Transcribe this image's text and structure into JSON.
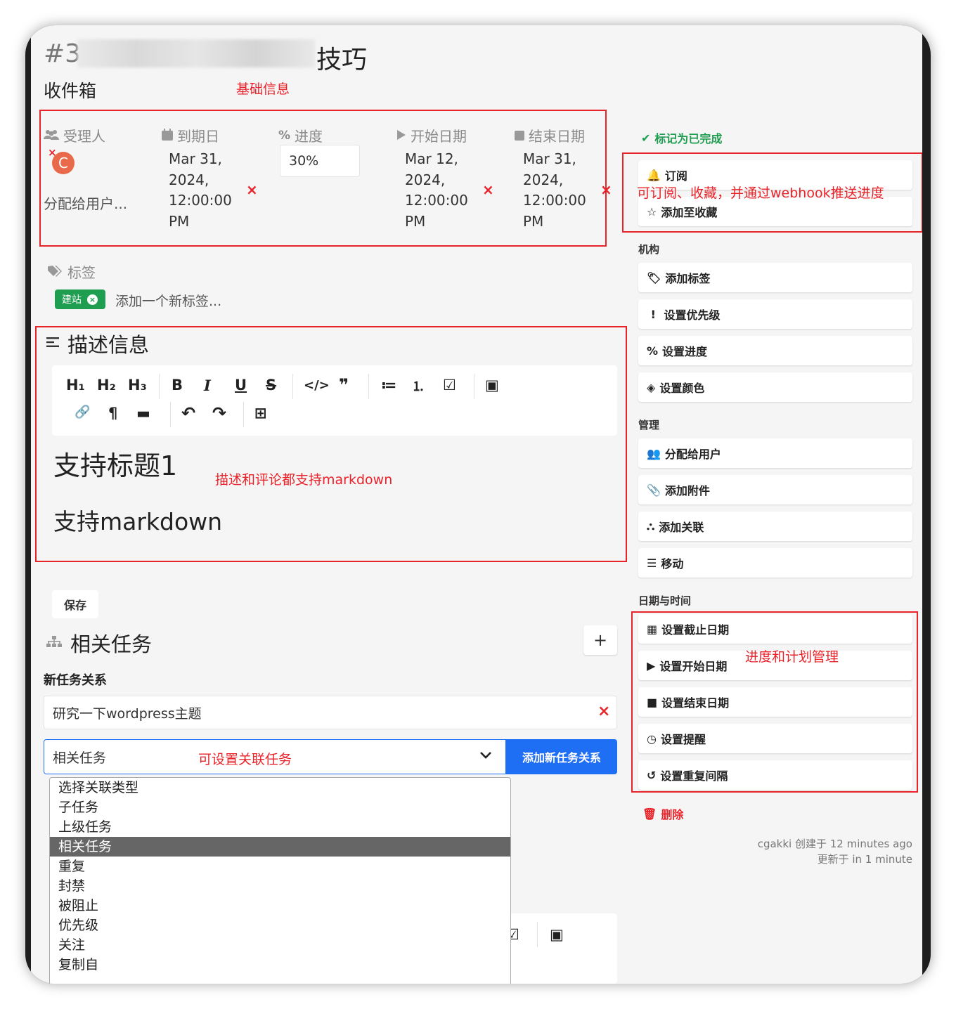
{
  "task": {
    "id_prefix": "#3",
    "title_tail": "技巧",
    "project": "收件箱"
  },
  "annotations": {
    "basic_info": "基础信息",
    "subscribe_note": "可订阅、收藏，并通过webhook推送进度",
    "markdown_note": "描述和评论都支持markdown",
    "relation_note": "可设置关联任务",
    "schedule_note": "进度和计划管理"
  },
  "meta": {
    "assignee_label": "受理人",
    "assignee_avatar": "C",
    "assignee_placeholder": "分配给用户...",
    "due_label": "到期日",
    "due_lines": [
      "Mar 31,",
      "2024,",
      "12:00:00",
      "PM"
    ],
    "progress_label": "进度",
    "progress_value": "30%",
    "start_label": "开始日期",
    "start_lines": [
      "Mar 12,",
      "2024,",
      "12:00:00",
      "PM"
    ],
    "end_label": "结束日期",
    "end_lines": [
      "Mar 31,",
      "2024,",
      "12:00:00",
      "PM"
    ],
    "clear_mark": "×"
  },
  "labels": {
    "heading": "标签",
    "tag": "建站",
    "placeholder": "添加一个新标签..."
  },
  "description": {
    "heading": "描述信息",
    "toolbar_row1": [
      "H₁",
      "H₂",
      "H₃",
      "B",
      "I",
      "U",
      "S",
      "</>",
      "❞",
      "≔",
      "⒈",
      "☑",
      "▣"
    ],
    "toolbar_row2": [
      "🔗",
      "¶",
      "▬",
      "↶",
      "↷",
      "⊞"
    ],
    "h1_text": "支持标题1",
    "p_text": "支持markdown",
    "save": "保存"
  },
  "related": {
    "heading": "相关任务",
    "add": "+",
    "new_relation_label": "新任务关系",
    "task_input": "研究一下wordpress主题",
    "relation_select": "相关任务",
    "add_button": "添加新任务关系",
    "options": [
      "选择关联类型",
      "子任务",
      "上级任务",
      "相关任务",
      "重复",
      "封禁",
      "被阻止",
      "优先级",
      "关注",
      "复制自"
    ],
    "selected_option": "相关任务"
  },
  "sidebar": {
    "done": "标记为已完成",
    "subscribe": "订阅",
    "favorite": "添加至收藏",
    "section_org": "机构",
    "add_label": "添加标签",
    "set_priority": "设置优先级",
    "set_progress": "设置进度",
    "set_color": "设置颜色",
    "section_manage": "管理",
    "assign_user": "分配给用户",
    "add_attachment": "添加附件",
    "add_relation": "添加关联",
    "move": "移动",
    "section_datetime": "日期与时间",
    "set_due": "设置截止日期",
    "set_start": "设置开始日期",
    "set_end": "设置结束日期",
    "set_reminder": "设置提醒",
    "set_repeat": "设置重复间隔",
    "delete": "删除",
    "created": "cgakki 创建于 12 minutes ago",
    "updated": "更新于 in 1 minute"
  },
  "colors": {
    "accent": "#1f6ff5",
    "annotation": "#e8232a",
    "done": "#1f9e51",
    "tag": "#1f9e51"
  }
}
